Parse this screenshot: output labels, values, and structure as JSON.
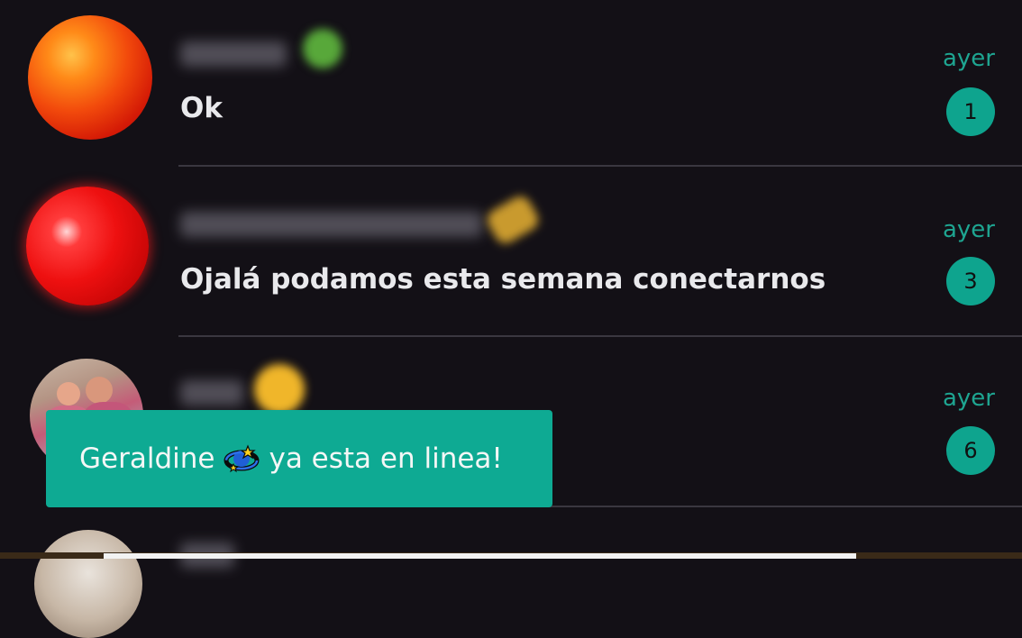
{
  "chats": [
    {
      "message": "Ok",
      "time": "ayer",
      "unread_count": "1",
      "avatar_icon": "orange-ball-avatar",
      "name_emoji_color": "#58a83a"
    },
    {
      "message": "Ojalá podamos esta semana conectarnos",
      "time": "ayer",
      "unread_count": "3",
      "avatar_icon": "red-ball-avatar",
      "name_emoji_color": "#c99a2e"
    },
    {
      "message": "",
      "time": "ayer",
      "unread_count": "6",
      "avatar_icon": "photo-avatar",
      "name_emoji_color": "#f0b62a"
    }
  ],
  "toast": {
    "name": "Geraldine",
    "text": "ya esta en linea!",
    "icon": "dizzy-planet-emoji"
  },
  "colors": {
    "background": "#131016",
    "accent": "#0eaa93",
    "time_text": "#1ea591",
    "message_text": "#e9e9ec"
  }
}
